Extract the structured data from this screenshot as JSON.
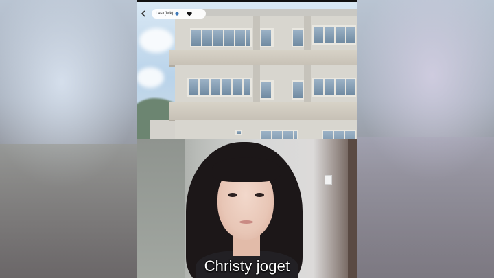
{
  "overlay": {
    "username": "Lask(lwk)",
    "back_icon": "chevron-left-icon",
    "globe_icon": "globe-icon",
    "heart_icon": "heart-icon"
  },
  "caption": {
    "text": "Christy joget"
  },
  "colors": {
    "caption_text": "#ffffff",
    "backdrop": "#9aa6b4"
  }
}
